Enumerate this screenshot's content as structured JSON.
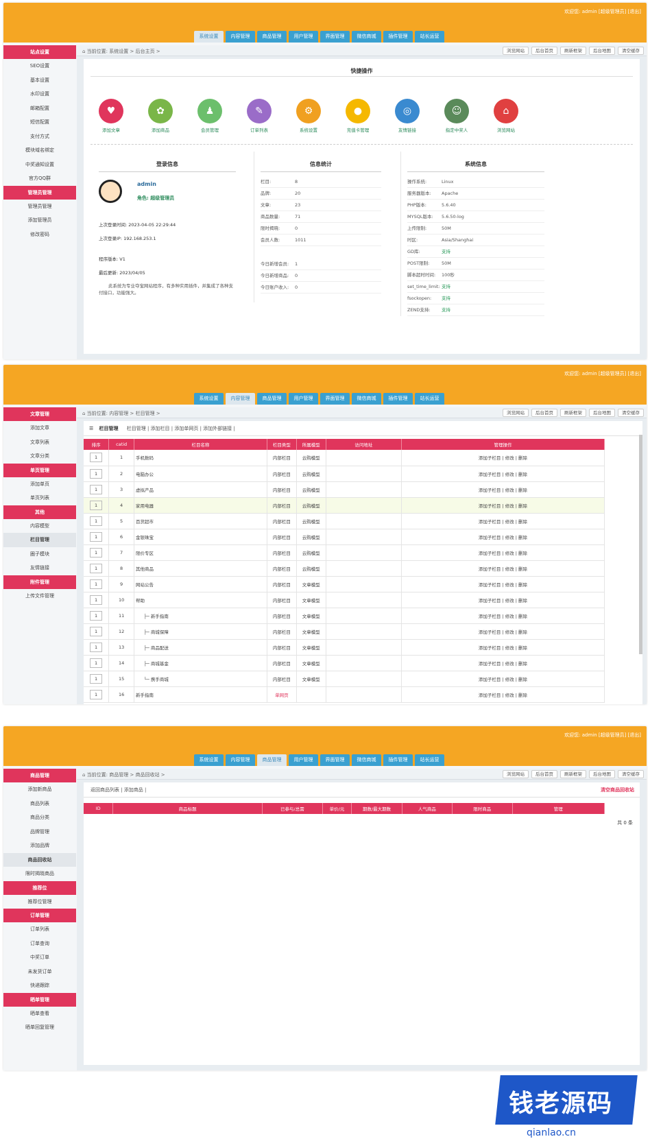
{
  "welcome": "欢迎您: admin [超级管理员] [退出]",
  "tabs": [
    "系统设置",
    "内容管理",
    "商品管理",
    "用户管理",
    "界面管理",
    "微信商城",
    "插件管理",
    "站长运营"
  ],
  "quick_buttons": [
    "浏览网站",
    "后台首页",
    "刷新框架",
    "后台地图",
    "清空缓存"
  ],
  "p1": {
    "crumb": "当前位置: 系统设置 > 后台主页 >",
    "sidebar": [
      {
        "t": "h",
        "l": "站点设置"
      },
      {
        "t": "i",
        "l": "SEO设置"
      },
      {
        "t": "i",
        "l": "基本设置"
      },
      {
        "t": "i",
        "l": "水印设置"
      },
      {
        "t": "i",
        "l": "邮箱配置"
      },
      {
        "t": "i",
        "l": "短信配置"
      },
      {
        "t": "i",
        "l": "支付方式"
      },
      {
        "t": "i",
        "l": "模块域名绑定"
      },
      {
        "t": "i",
        "l": "中奖通知设置"
      },
      {
        "t": "i",
        "l": "官方QQ群"
      },
      {
        "t": "h",
        "l": "管理员管理"
      },
      {
        "t": "i",
        "l": "管理员管理"
      },
      {
        "t": "i",
        "l": "添加管理员"
      },
      {
        "t": "i",
        "l": "修改密码"
      }
    ],
    "quick_title": "快捷操作",
    "icons": [
      {
        "l": "添加文章",
        "c": "#e0355c",
        "g": "♥"
      },
      {
        "l": "添加商品",
        "c": "#7ab648",
        "g": "✿"
      },
      {
        "l": "会员管理",
        "c": "#6cbf6c",
        "g": "♟"
      },
      {
        "l": "订单列表",
        "c": "#9a6cc8",
        "g": "✎"
      },
      {
        "l": "系统设置",
        "c": "#f0a020",
        "g": "⚙"
      },
      {
        "l": "充值卡管理",
        "c": "#f5b800",
        "g": "●"
      },
      {
        "l": "友情链接",
        "c": "#3a8ad0",
        "g": "◎"
      },
      {
        "l": "指定中奖人",
        "c": "#5a8a5a",
        "g": "☺"
      },
      {
        "l": "浏览网站",
        "c": "#e04040",
        "g": "⌂"
      }
    ],
    "login": {
      "title": "登录信息",
      "name": "admin",
      "role": "角色: 超级管理员",
      "last_time": "上次登录时间: 2023-04-05 22:29:44",
      "last_ip": "上次登录IP: 192.168.253.1",
      "version": "程序版本: V1",
      "updated": "最后更新: 2023/04/05",
      "desc": "此系统为专业夺宝网站程序，有多种实用插件，并集成了各种支付接口，功能强大。"
    },
    "stats": {
      "title": "信息统计",
      "rows": [
        [
          "栏目:",
          "8"
        ],
        [
          "品牌:",
          "20"
        ],
        [
          "文章:",
          "23"
        ],
        [
          "商品数量:",
          "71"
        ],
        [
          "限时揭晓:",
          "0"
        ],
        [
          "会员人数:",
          "1011"
        ]
      ],
      "rows2": [
        [
          "今日新增会员:",
          "1"
        ],
        [
          "今日新增商品:",
          "0"
        ],
        [
          "今日账户收入:",
          "0"
        ]
      ]
    },
    "sys": {
      "title": "系统信息",
      "rows": [
        [
          "操作系统:",
          "Linux"
        ],
        [
          "服务器版本:",
          "Apache"
        ],
        [
          "PHP版本:",
          "5.6.40"
        ],
        [
          "MYSQL版本:",
          "5.6.50-log"
        ],
        [
          "上传限制:",
          "50M"
        ],
        [
          "时区:",
          "Asia/Shanghai"
        ],
        [
          "GD库:",
          "支持"
        ],
        [
          "POST限制:",
          "50M"
        ],
        [
          "脚本超时时间:",
          "100秒"
        ],
        [
          "set_time_limit:",
          "支持"
        ],
        [
          "fsockopen:",
          "支持"
        ],
        [
          "ZEND支持:",
          "支持"
        ]
      ]
    }
  },
  "p2": {
    "crumb": "当前位置: 内容管理 > 栏目管理 >",
    "sidebar": [
      {
        "t": "h",
        "l": "文章管理"
      },
      {
        "t": "i",
        "l": "添加文章"
      },
      {
        "t": "i",
        "l": "文章列表"
      },
      {
        "t": "i",
        "l": "文章分类"
      },
      {
        "t": "h",
        "l": "单页管理"
      },
      {
        "t": "i",
        "l": "添加单页"
      },
      {
        "t": "i",
        "l": "单页列表"
      },
      {
        "t": "h",
        "l": "其他"
      },
      {
        "t": "i",
        "l": "内容模型"
      },
      {
        "t": "s",
        "l": "栏目管理"
      },
      {
        "t": "i",
        "l": "圈子模块"
      },
      {
        "t": "i",
        "l": "友情链接"
      },
      {
        "t": "h",
        "l": "附件管理"
      },
      {
        "t": "i",
        "l": "上传文件管理"
      }
    ],
    "title": "栏目管理",
    "links": "栏目管理 | 添加栏目 | 添加单网页 | 添加外部链接 |",
    "headers": [
      "排序",
      "catid",
      "栏目名称",
      "栏目类型",
      "所属模型",
      "访问地址",
      "管理操作"
    ],
    "rows": [
      [
        "1",
        "1",
        "手机数码",
        "内部栏目",
        "云购模型"
      ],
      [
        "1",
        "2",
        "电脑办公",
        "内部栏目",
        "云购模型"
      ],
      [
        "1",
        "3",
        "虚拟产品",
        "内部栏目",
        "云购模型"
      ],
      [
        "1",
        "4",
        "家用电器",
        "内部栏目",
        "云购模型"
      ],
      [
        "1",
        "5",
        "百货超市",
        "内部栏目",
        "云购模型"
      ],
      [
        "1",
        "6",
        "金银珠宝",
        "内部栏目",
        "云购模型"
      ],
      [
        "1",
        "7",
        "限价专区",
        "内部栏目",
        "云购模型"
      ],
      [
        "1",
        "8",
        "其他商品",
        "内部栏目",
        "云购模型"
      ],
      [
        "1",
        "9",
        "网站公告",
        "内部栏目",
        "文章模型"
      ],
      [
        "1",
        "10",
        "帮助",
        "内部栏目",
        "文章模型"
      ],
      [
        "1",
        "11",
        "├─ 新手指南",
        "内部栏目",
        "文章模型"
      ],
      [
        "1",
        "12",
        "├─ 商城保障",
        "内部栏目",
        "文章模型"
      ],
      [
        "1",
        "13",
        "├─ 商品配送",
        "内部栏目",
        "文章模型"
      ],
      [
        "1",
        "14",
        "├─ 商城基金",
        "内部栏目",
        "文章模型"
      ],
      [
        "1",
        "15",
        "└─ 携手商城",
        "内部栏目",
        "文章模型"
      ],
      [
        "1",
        "16",
        "新手指南",
        "单网页",
        ""
      ]
    ],
    "ops": "添加子栏目 | 修改 | 删除"
  },
  "p3": {
    "crumb": "当前位置: 商品管理 > 商品回收站 >",
    "sidebar": [
      {
        "t": "h",
        "l": "商品管理"
      },
      {
        "t": "i",
        "l": "添加新商品"
      },
      {
        "t": "i",
        "l": "商品列表"
      },
      {
        "t": "i",
        "l": "商品分类"
      },
      {
        "t": "i",
        "l": "品牌管理"
      },
      {
        "t": "i",
        "l": "添加品牌"
      },
      {
        "t": "s",
        "l": "商品回收站"
      },
      {
        "t": "i",
        "l": "限时揭晓商品"
      },
      {
        "t": "h",
        "l": "推荐位"
      },
      {
        "t": "i",
        "l": "推荐位管理"
      },
      {
        "t": "h",
        "l": "订单管理"
      },
      {
        "t": "i",
        "l": "订单列表"
      },
      {
        "t": "i",
        "l": "订单查询"
      },
      {
        "t": "i",
        "l": "中奖订单"
      },
      {
        "t": "i",
        "l": "未发货订单"
      },
      {
        "t": "i",
        "l": "快递跟踪"
      },
      {
        "t": "h",
        "l": "晒单管理"
      },
      {
        "t": "i",
        "l": "晒单查看"
      },
      {
        "t": "i",
        "l": "晒单回复管理"
      }
    ],
    "links": "返回商品列表 | 添加商品 |",
    "clear": "清空商品回收站",
    "headers": [
      "ID",
      "商品标题",
      "已参与/总需",
      "单价/元",
      "期数/最大期数",
      "人气商品",
      "限时商品",
      "管理"
    ],
    "total": "共 0 条"
  },
  "watermark": {
    "title": "钱老源码",
    "url": "qianlao.cn"
  }
}
